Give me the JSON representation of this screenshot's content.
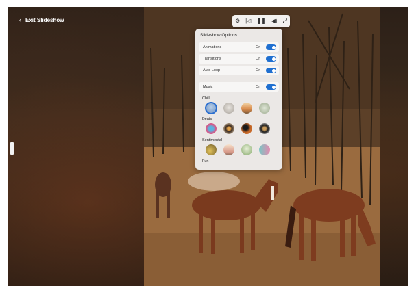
{
  "header": {
    "back_chevron": "‹",
    "exit_label": "Exit Slideshow"
  },
  "controls": {
    "icons": [
      "settings-icon",
      "previous-icon",
      "pause-icon",
      "volume-icon",
      "exit-fullscreen-icon"
    ],
    "glyphs": [
      "⚙",
      "|◁",
      "❚❚",
      "◀)",
      "⤢"
    ]
  },
  "panel": {
    "title": "Slideshow Options",
    "rows": [
      {
        "label": "Animations",
        "state": "On"
      },
      {
        "label": "Transitions",
        "state": "On"
      },
      {
        "label": "Auto Loop",
        "state": "On"
      }
    ],
    "music": {
      "label": "Music",
      "state": "On"
    },
    "categories": [
      {
        "name": "Chill",
        "thumbs": [
          "#8fb0d8",
          "#c7c1b8",
          "#d99a5c",
          "#b7c2a8"
        ],
        "selected": 0
      },
      {
        "name": "Beats",
        "thumbs": [
          "#d45a8a",
          "#3a2a20",
          "#c86a2a",
          "#1e1e1e"
        ],
        "selected": -1
      },
      {
        "name": "Sentimental",
        "thumbs": [
          "#b89a3a",
          "#e8c8a8",
          "#a9c58a",
          "#7ac7c4"
        ],
        "selected": -1
      },
      {
        "name": "Fun",
        "thumbs": [],
        "selected": -1
      }
    ]
  },
  "colors": {
    "accent": "#1f6fd0",
    "panel_bg": "#ebe8e6"
  }
}
